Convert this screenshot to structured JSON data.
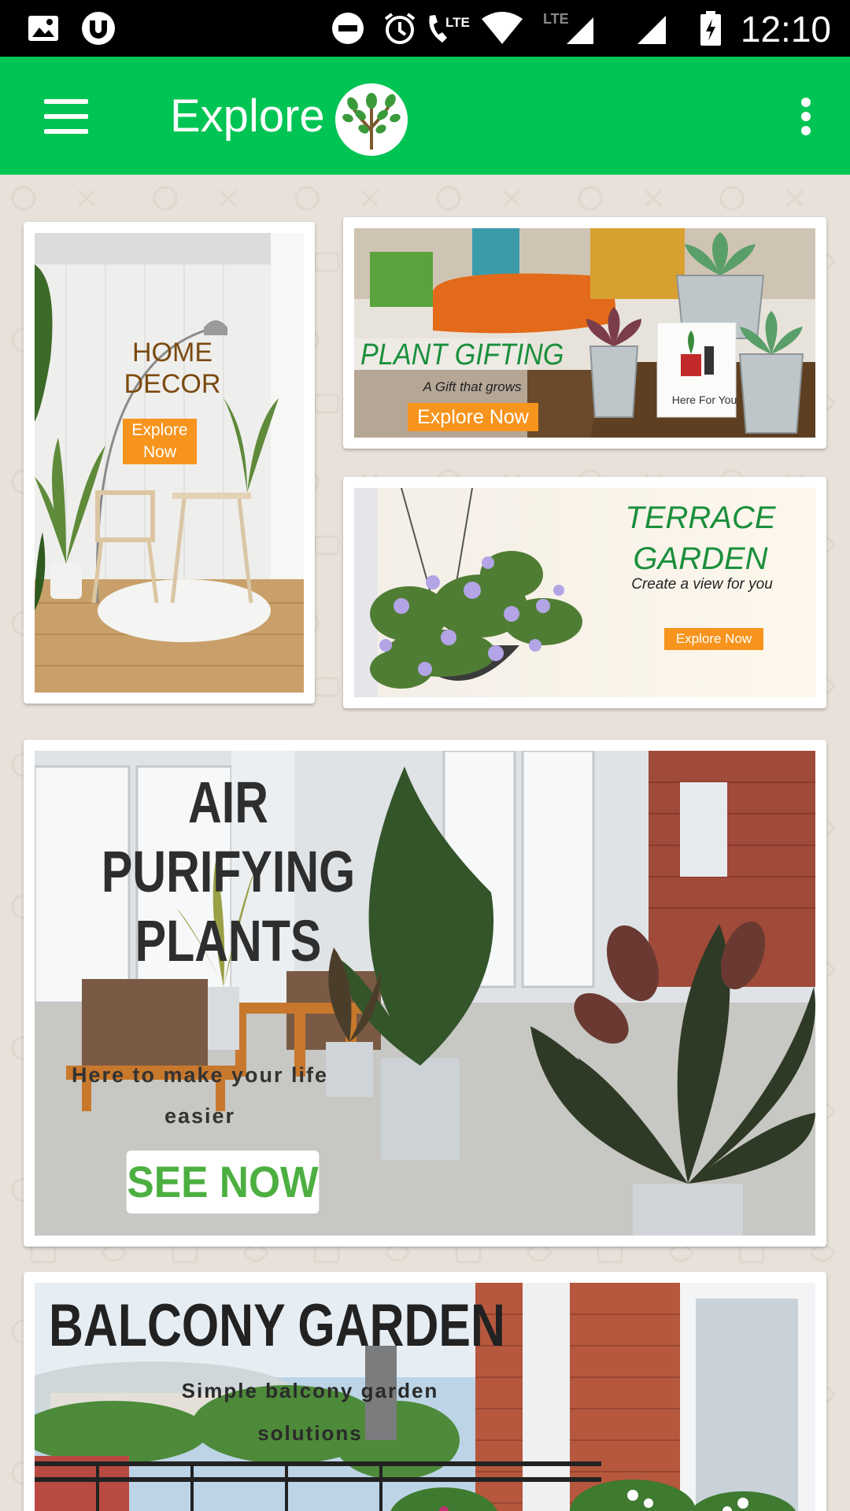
{
  "status_bar": {
    "time": "12:10",
    "network": "LTE"
  },
  "app_bar": {
    "title": "Explore",
    "menu_icon": "hamburger-menu-icon",
    "overflow_icon": "more-vert-icon",
    "logo": "tree-logo"
  },
  "colors": {
    "app_bar": "#00c453",
    "status_bar": "#000000",
    "background": "#e7e1d9",
    "cta_orange": "#f7941d",
    "green_text": "#1a8f3c"
  },
  "cards": {
    "home_decor": {
      "title_line1": "HOME",
      "title_line2": "DECOR",
      "cta_line1": "Explore",
      "cta_line2": "Now"
    },
    "plant_gifting": {
      "title": "PLANT GIFTING",
      "subtitle": "A Gift that grows",
      "cta": "Explore Now",
      "card_text": "Here For You"
    },
    "terrace_garden": {
      "title_line1": "TERRACE",
      "title_line2": "GARDEN",
      "subtitle": "Create a view for you",
      "cta": "Explore Now"
    },
    "air_purifying": {
      "title_line1": "AIR PURIFYING",
      "title_line2": "PLANTS",
      "subtitle_line1": "Here to make your life",
      "subtitle_line2": "easier",
      "cta": "SEE NOW"
    },
    "balcony_garden": {
      "title": "BALCONY GARDEN",
      "subtitle_line1": "Simple balcony garden",
      "subtitle_line2": "solutions"
    }
  }
}
